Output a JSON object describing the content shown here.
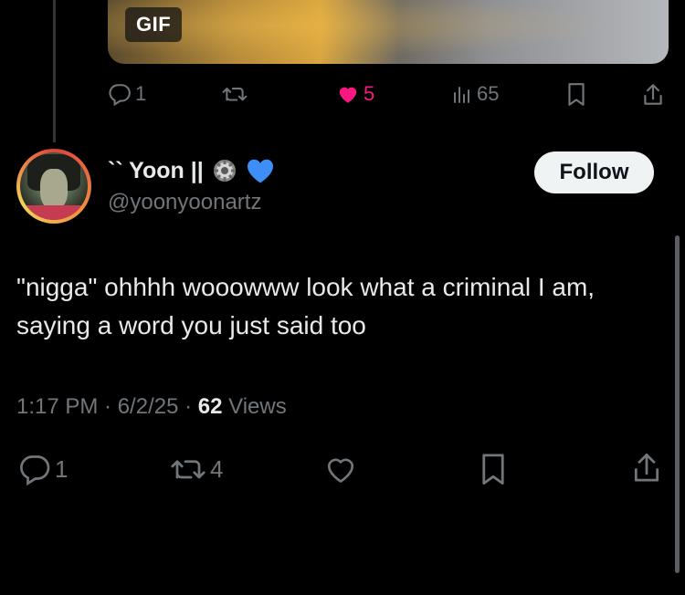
{
  "previous_tweet": {
    "media_badge": "GIF",
    "actions": {
      "replies": "1",
      "likes": "5",
      "views": "65"
    },
    "liked_color": "#f91880"
  },
  "tweet": {
    "author": {
      "display_name": "`` Yoon || ⚙️💙",
      "name_text": "`` Yoon ||",
      "handle": "@yoonyoonartz"
    },
    "follow_label": "Follow",
    "text": "\"nigga\" ohhhh wooowww look what a criminal I am, saying a word you just said too",
    "timestamp": "1:17 PM · 6/2/25 · ",
    "views_count": "62",
    "views_label": " Views",
    "actions": {
      "replies": "1",
      "reposts": "4"
    }
  },
  "icons": [
    "reply-icon",
    "repost-icon",
    "like-icon",
    "views-icon",
    "bookmark-icon",
    "share-icon",
    "gear-icon",
    "blue-heart-icon"
  ],
  "colors": {
    "background": "#000000",
    "text": "#e7e9ea",
    "muted": "#71767b",
    "follow_button": "#eff3f4"
  }
}
